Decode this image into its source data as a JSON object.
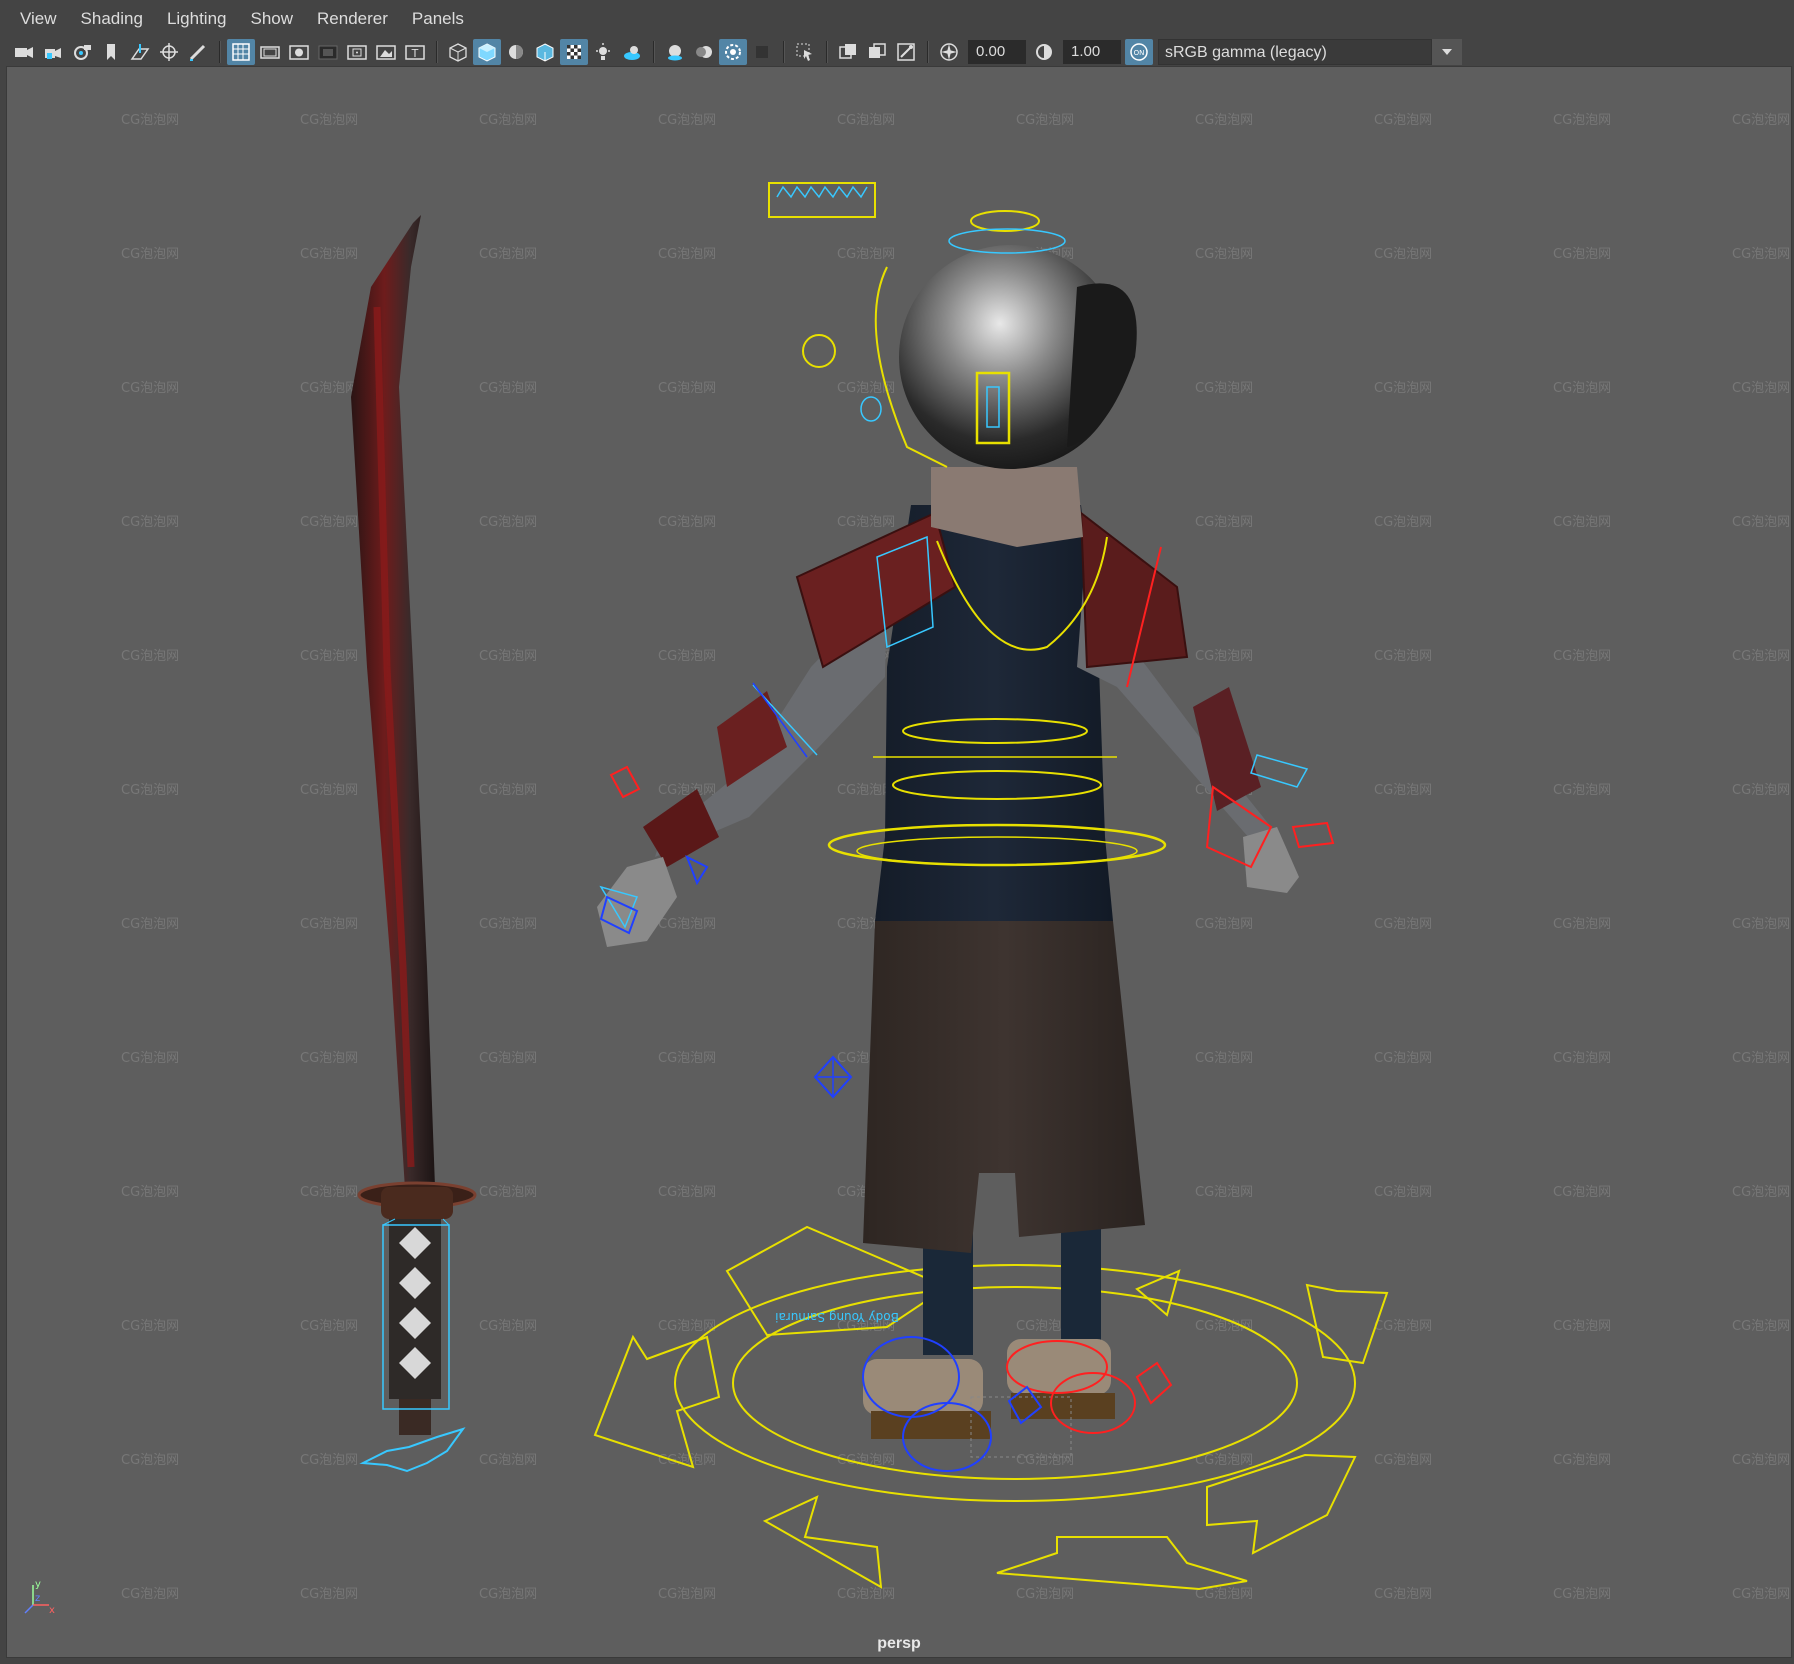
{
  "menu": {
    "items": [
      {
        "label": "View"
      },
      {
        "label": "Shading"
      },
      {
        "label": "Lighting"
      },
      {
        "label": "Show"
      },
      {
        "label": "Renderer"
      },
      {
        "label": "Panels"
      }
    ]
  },
  "toolbar": {
    "exposure_value": "0.00",
    "gamma_value": "1.00",
    "color_management_badge": "ON",
    "color_space": "sRGB gamma (legacy)"
  },
  "viewport": {
    "camera_label": "persp",
    "watermark_text": "CG泡泡网",
    "ground_label": "Body Young Samurai",
    "axis_labels": {
      "x": "x",
      "y": "y",
      "z": "z"
    }
  },
  "colors": {
    "background": "#5e5e5e",
    "toolbar_active": "#5285a6",
    "control_yellow": "#e8e000",
    "control_cyan": "#38c8ff",
    "control_red": "#ff2020",
    "control_blue": "#2040ff"
  }
}
